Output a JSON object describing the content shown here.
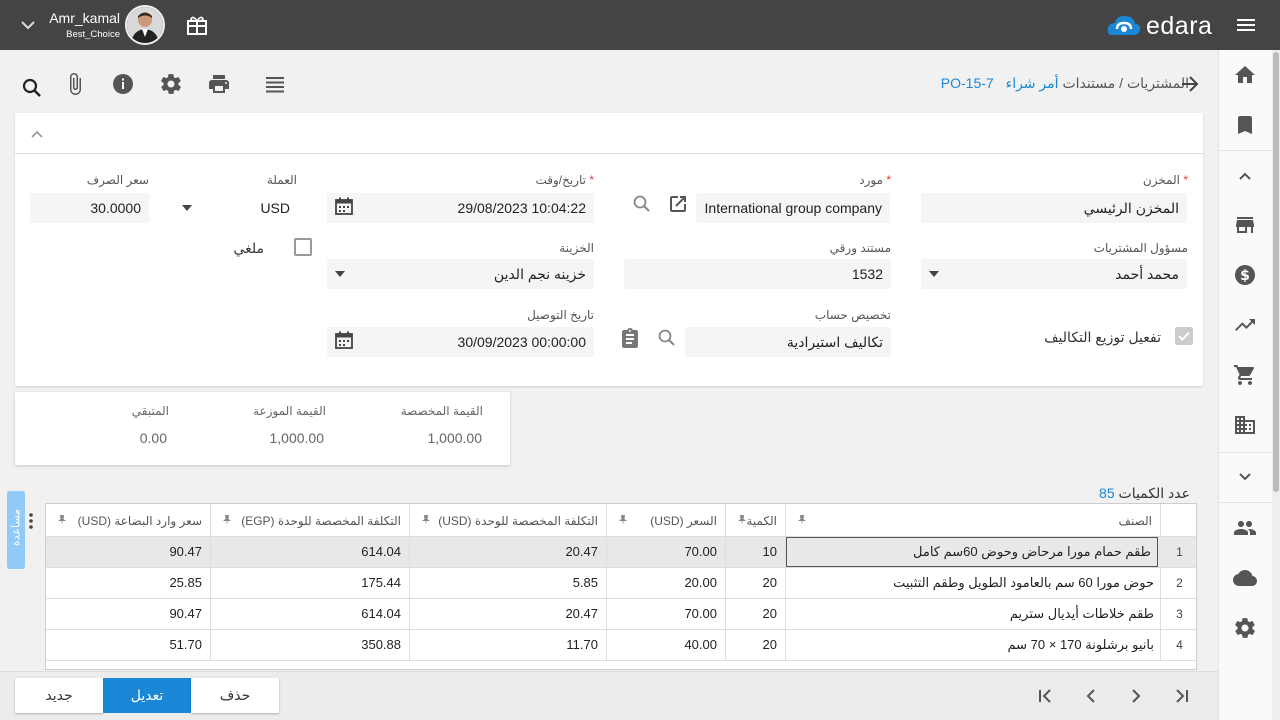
{
  "user": {
    "name": "Amr_kamal",
    "company": "Best_Choice"
  },
  "brand": {
    "name": "edara",
    "accent": "#1a88d6"
  },
  "breadcrumb": {
    "section": "المشتريات / مستندات",
    "doc_type": "أمر شراء",
    "doc_code": "PO-15-7"
  },
  "form": {
    "warehouse": {
      "label": "المخزن",
      "value": "المخزن الرئيسي"
    },
    "supplier": {
      "label": "مورد",
      "value": "International group company"
    },
    "datetime": {
      "label": "تاريخ/وقت",
      "value": "29/08/2023 10:04:22"
    },
    "currency": {
      "label": "العملة",
      "value": "USD"
    },
    "rate": {
      "label": "سعر الصرف",
      "value": "30.0000"
    },
    "buyer": {
      "label": "مسؤول المشتريات",
      "value": "محمد أحمد"
    },
    "paper_doc": {
      "label": "مستند ورقي",
      "value": "1532"
    },
    "treasury": {
      "label": "الخزينة",
      "value": "خزينه نجم الدين"
    },
    "cancelled": {
      "label": "ملغي",
      "checked": false
    },
    "cost_dist": {
      "label": "تفعيل توزيع التكاليف",
      "checked": true
    },
    "account": {
      "label": "تخصيص حساب",
      "value": "تكاليف استيرادية"
    },
    "delivery": {
      "label": "تاريخ التوصيل",
      "value": "30/09/2023 00:00:00"
    }
  },
  "totals": {
    "allocated": {
      "label": "القيمة المخصصة",
      "value": "1,000.00"
    },
    "distributed": {
      "label": "القيمة الموزعة",
      "value": "1,000.00"
    },
    "remaining": {
      "label": "المتبقي",
      "value": "0.00"
    }
  },
  "qty_count": {
    "label": "عدد الكميات",
    "value": "85"
  },
  "helper_label": "مساعدة",
  "grid": {
    "columns": [
      "الصنف",
      "الكمية",
      "السعر (USD)",
      "التكلفة المخصصة للوحدة (USD)",
      "التكلفة المخصصة للوحدة (EGP)",
      "سعر وارد البضاعة (USD)"
    ],
    "rows": [
      {
        "idx": "1",
        "item": "طقم حمام مورا مرحاض وحوض 60سم كامل",
        "qty": "10",
        "price": "70.00",
        "unit_usd": "20.47",
        "unit_egp": "614.04",
        "landed": "90.47"
      },
      {
        "idx": "2",
        "item": "حوض مورا 60 سم بالعامود الطويل وطقم التثبيت",
        "qty": "20",
        "price": "20.00",
        "unit_usd": "5.85",
        "unit_egp": "175.44",
        "landed": "25.85"
      },
      {
        "idx": "3",
        "item": "طقم خلاطات أيديال ستريم",
        "qty": "20",
        "price": "70.00",
        "unit_usd": "20.47",
        "unit_egp": "614.04",
        "landed": "90.47"
      },
      {
        "idx": "4",
        "item": "بانيو برشلونة 170 × 70 سم",
        "qty": "20",
        "price": "40.00",
        "unit_usd": "11.70",
        "unit_egp": "350.88",
        "landed": "51.70"
      }
    ]
  },
  "buttons": {
    "new": "جديد",
    "edit": "تعديل",
    "delete": "حذف"
  }
}
